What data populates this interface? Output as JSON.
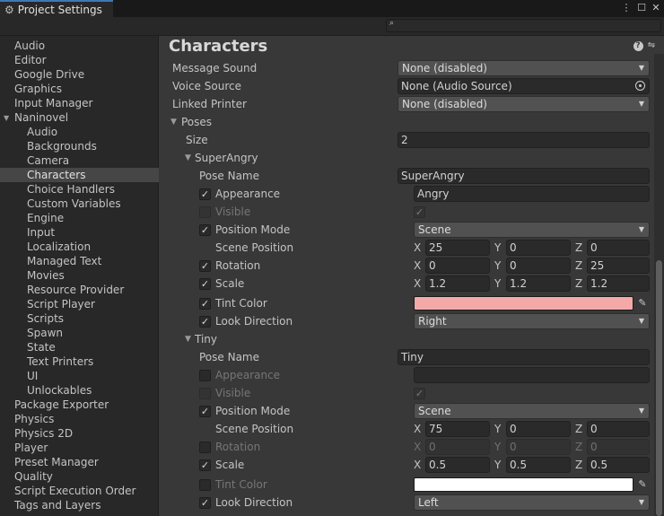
{
  "window": {
    "tab_title": "Project Settings",
    "tab_icon": "gear-icon",
    "search_placeholder": ""
  },
  "sidebar": {
    "items": [
      {
        "label": "Audio",
        "level": 1
      },
      {
        "label": "Editor",
        "level": 1
      },
      {
        "label": "Google Drive",
        "level": 1
      },
      {
        "label": "Graphics",
        "level": 1
      },
      {
        "label": "Input Manager",
        "level": 1
      },
      {
        "label": "Naninovel",
        "level": 1,
        "expanded": true
      },
      {
        "label": "Audio",
        "level": 2
      },
      {
        "label": "Backgrounds",
        "level": 2
      },
      {
        "label": "Camera",
        "level": 2
      },
      {
        "label": "Characters",
        "level": 2,
        "selected": true
      },
      {
        "label": "Choice Handlers",
        "level": 2
      },
      {
        "label": "Custom Variables",
        "level": 2
      },
      {
        "label": "Engine",
        "level": 2
      },
      {
        "label": "Input",
        "level": 2
      },
      {
        "label": "Localization",
        "level": 2
      },
      {
        "label": "Managed Text",
        "level": 2
      },
      {
        "label": "Movies",
        "level": 2
      },
      {
        "label": "Resource Provider",
        "level": 2
      },
      {
        "label": "Script Player",
        "level": 2
      },
      {
        "label": "Scripts",
        "level": 2
      },
      {
        "label": "Spawn",
        "level": 2
      },
      {
        "label": "State",
        "level": 2
      },
      {
        "label": "Text Printers",
        "level": 2
      },
      {
        "label": "UI",
        "level": 2
      },
      {
        "label": "Unlockables",
        "level": 2
      },
      {
        "label": "Package Exporter",
        "level": 1
      },
      {
        "label": "Physics",
        "level": 1
      },
      {
        "label": "Physics 2D",
        "level": 1
      },
      {
        "label": "Player",
        "level": 1
      },
      {
        "label": "Preset Manager",
        "level": 1
      },
      {
        "label": "Quality",
        "level": 1
      },
      {
        "label": "Script Execution Order",
        "level": 1
      },
      {
        "label": "Tags and Layers",
        "level": 1
      }
    ]
  },
  "main": {
    "title": "Characters",
    "message_sound": {
      "label": "Message Sound",
      "value": "None (disabled)"
    },
    "voice_source": {
      "label": "Voice Source",
      "value": "None (Audio Source)"
    },
    "linked_printer": {
      "label": "Linked Printer",
      "value": "None (disabled)"
    },
    "poses": {
      "label": "Poses",
      "size_label": "Size",
      "size_value": "2"
    },
    "pose1": {
      "header": "SuperAngry",
      "pose_name_label": "Pose Name",
      "pose_name": "SuperAngry",
      "appearance_label": "Appearance",
      "appearance": "Angry",
      "appearance_checked": true,
      "visible_label": "Visible",
      "visible_checked": false,
      "position_mode_label": "Position Mode",
      "position_mode": "Scene",
      "position_mode_checked": true,
      "scene_position_label": "Scene Position",
      "scene_x": "25",
      "scene_y": "0",
      "scene_z": "0",
      "rotation_label": "Rotation",
      "rotation_checked": true,
      "rot_x": "0",
      "rot_y": "0",
      "rot_z": "25",
      "scale_label": "Scale",
      "scale_checked": true,
      "scale_x": "1.2",
      "scale_y": "1.2",
      "scale_z": "1.2",
      "tint_label": "Tint Color",
      "tint_checked": true,
      "tint_color": "#f4a9a9",
      "look_label": "Look Direction",
      "look_checked": true,
      "look_direction": "Right"
    },
    "pose2": {
      "header": "Tiny",
      "pose_name_label": "Pose Name",
      "pose_name": "Tiny",
      "appearance_label": "Appearance",
      "appearance": "",
      "appearance_checked": false,
      "visible_label": "Visible",
      "visible_checked": false,
      "position_mode_label": "Position Mode",
      "position_mode": "Scene",
      "position_mode_checked": true,
      "scene_position_label": "Scene Position",
      "scene_x": "75",
      "scene_y": "0",
      "scene_z": "0",
      "rotation_label": "Rotation",
      "rotation_checked": false,
      "rot_x": "0",
      "rot_y": "0",
      "rot_z": "0",
      "scale_label": "Scale",
      "scale_checked": true,
      "scale_x": "0.5",
      "scale_y": "0.5",
      "scale_z": "0.5",
      "tint_label": "Tint Color",
      "tint_checked": false,
      "tint_color": "#ffffff",
      "look_label": "Look Direction",
      "look_checked": true,
      "look_direction": "Left"
    },
    "axis": {
      "x": "X",
      "y": "Y",
      "z": "Z"
    }
  },
  "glyphs": {
    "check": "✓",
    "caret": "▼",
    "fold_open": "▼",
    "fold_closed": "▶",
    "search": "🔍",
    "gear": "⚙",
    "help": "?",
    "more": "⋮",
    "maximize": "☐",
    "close": "✕",
    "picker": "✎"
  }
}
